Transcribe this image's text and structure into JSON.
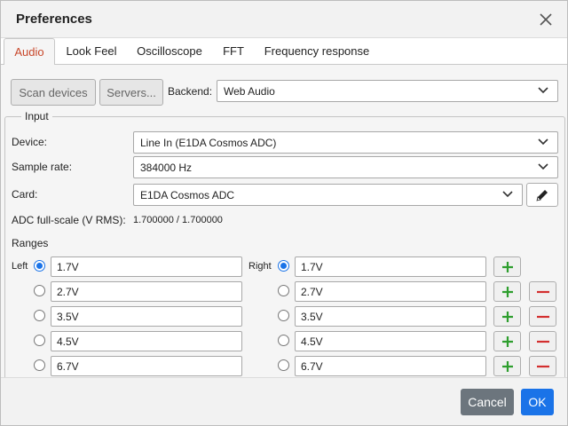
{
  "window": {
    "title": "Preferences"
  },
  "tabs": [
    {
      "label": "Audio",
      "active": true
    },
    {
      "label": "Look Feel"
    },
    {
      "label": "Oscilloscope"
    },
    {
      "label": "FFT"
    },
    {
      "label": "Frequency response"
    }
  ],
  "toolbar": {
    "scan_label": "Scan devices",
    "servers_label": "Servers...",
    "backend_label": "Backend:",
    "backend_value": "Web Audio"
  },
  "input": {
    "legend": "Input",
    "device_label": "Device:",
    "device_value": "Line In (E1DA Cosmos ADC)",
    "sample_rate_label": "Sample rate:",
    "sample_rate_value": "384000 Hz",
    "card_label": "Card:",
    "card_value": "E1DA Cosmos ADC",
    "adc_label": "ADC full-scale (V RMS):",
    "adc_value": "1.700000 / 1.700000",
    "ranges_label": "Ranges",
    "left_label": "Left",
    "right_label": "Right",
    "left_ranges": [
      "1.7V",
      "2.7V",
      "3.5V",
      "4.5V",
      "6.7V"
    ],
    "right_ranges": [
      "1.7V",
      "2.7V",
      "3.5V",
      "4.5V",
      "6.7V"
    ],
    "left_selected": 0,
    "right_selected": 0
  },
  "footer": {
    "cancel_label": "Cancel",
    "ok_label": "OK"
  },
  "colors": {
    "accent": "#1a73e8",
    "active_tab": "#c8472a",
    "add_green": "#2e9e2e",
    "remove_red": "#d32f2f",
    "cancel_bg": "#6c757d",
    "ok_bg": "#1a73e8"
  },
  "icons": {
    "close": "close-icon",
    "chevron": "chevron-down-icon",
    "edit": "pencil-icon",
    "add": "plus-icon",
    "remove": "minus-icon"
  }
}
